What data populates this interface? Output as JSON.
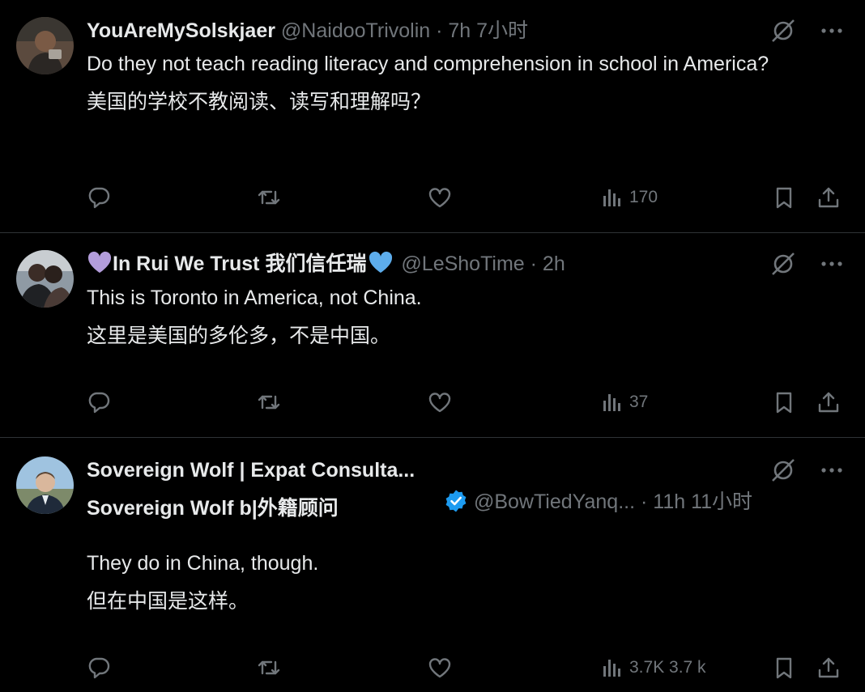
{
  "tweets": [
    {
      "display_name": "YouAreMySolskjaer",
      "handle": "@NaidooTrivolin",
      "time": "· 7h 7小时",
      "text_en": "Do they not teach reading literacy and comprehension in school in America?",
      "text_zh": "美国的学校不教阅读、读写和理解吗？",
      "views": "170"
    },
    {
      "name_prefix_emoji": "purple-heart",
      "display_name": "In Rui We Trust 我们信任瑞",
      "name_suffix_emoji": "blue-heart",
      "handle": "@LeShoTime",
      "time": "· 2h",
      "text_en": "This is Toronto in America, not China.",
      "text_zh": "这里是美国的多伦多，不是中国。",
      "views": "37"
    },
    {
      "display_name": "Sovereign Wolf | Expat Consulta...",
      "display_name_zh": "Sovereign Wolf b|外籍顾问",
      "verified": true,
      "handle": "@BowTiedYanq...",
      "time": "· 11h 11小时",
      "text_en": "They do in China, though.",
      "text_zh": "但在中国是这样。",
      "views": "3.7K 3.7 k"
    }
  ],
  "colors": {
    "background": "#000000",
    "text": "#e7e9ea",
    "muted": "#71767b",
    "divider": "#2f3336",
    "verified_blue": "#1d9bf0",
    "purple_heart": "#b39ddb",
    "blue_heart": "#5dadec"
  },
  "icons": [
    "reply-icon",
    "retweet-icon",
    "like-icon",
    "views-icon",
    "bookmark-icon",
    "share-icon",
    "grok-icon",
    "more-icon"
  ]
}
